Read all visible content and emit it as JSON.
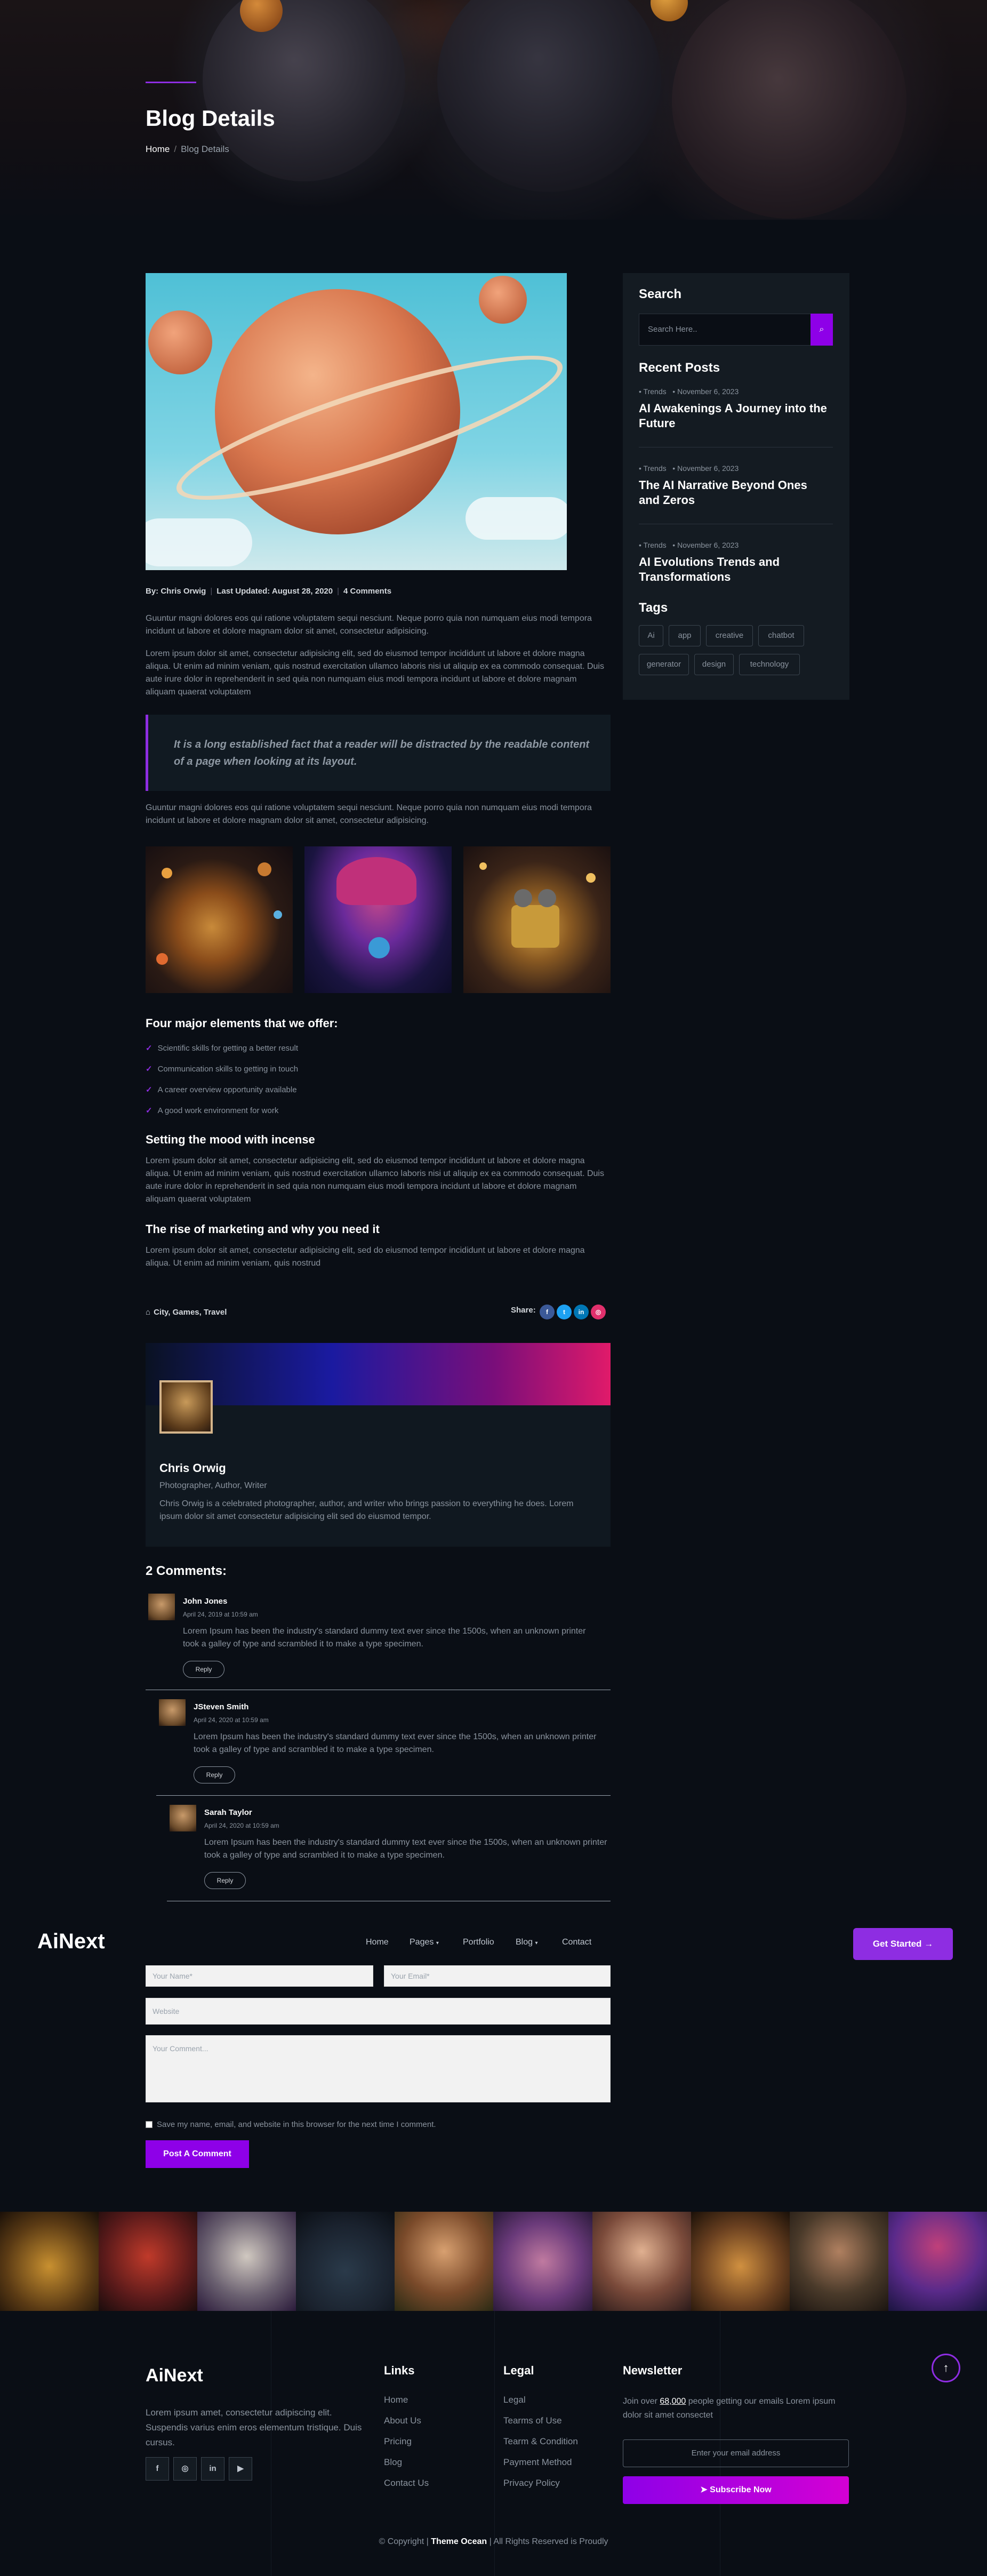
{
  "hero": {
    "title": "Blog Details",
    "breadcrumb": {
      "home": "Home",
      "separator": "/",
      "current": "Blog Details"
    }
  },
  "post": {
    "meta": {
      "author": "By: Chris Orwig",
      "updated": "Last Updated: August 28, 2020",
      "comments": "4 Comments"
    },
    "para1": "Guuntur magni dolores eos qui ratione voluptatem sequi nesciunt. Neque porro quia non numquam eius modi tempora incidunt ut labore et dolore magnam dolor sit amet, consectetur adipisicing.",
    "para2": "Lorem ipsum dolor sit amet, consectetur adipisicing elit, sed do eiusmod tempor incididunt ut labore et dolore magna aliqua. Ut enim ad minim veniam, quis nostrud exercitation ullamco laboris nisi ut aliquip ex ea commodo consequat. Duis aute irure dolor in reprehenderit in sed quia non numquam eius modi tempora incidunt ut labore et dolore magnam aliquam quaerat voluptatem",
    "quote": "It is a long established fact that a reader will be distracted by the readable content of a page when looking at its layout.",
    "para3": "Guuntur magni dolores eos qui ratione voluptatem sequi nesciunt. Neque porro quia non numquam eius modi tempora incidunt ut labore et dolore magnam dolor sit amet, consectetur adipisicing.",
    "elements_heading": "Four major elements that we offer:",
    "elements": [
      "Scientific skills for getting a better result",
      "Communication skills to getting in touch",
      "A career overview opportunity available",
      "A good work environment for work"
    ],
    "mood_heading": "Setting the mood with incense",
    "mood_text": "Lorem ipsum dolor sit amet, consectetur adipisicing elit, sed do eiusmod tempor incididunt ut labore et dolore magna aliqua. Ut enim ad minim veniam, quis nostrud exercitation ullamco laboris nisi ut aliquip ex ea commodo consequat. Duis aute irure dolor in reprehenderit in sed quia non numquam eius modi tempora incidunt ut labore et dolore magnam aliquam quaerat voluptatem",
    "rise_heading": "The rise of marketing and why you need it",
    "rise_text": "Lorem ipsum dolor sit amet, consectetur adipisicing elit, sed do eiusmod tempor incididunt ut labore et dolore magna aliqua. Ut enim ad minim veniam, quis nostrud",
    "tags_line": "City, Games, Travel",
    "share_label": "Share:",
    "share_icons": [
      "f",
      "t",
      "in",
      "◎"
    ]
  },
  "author": {
    "name": "Chris Orwig",
    "role": "Photographer, Author, Writer",
    "bio": "Chris Orwig is a celebrated photographer, author, and writer who brings passion to everything he does. Lorem ipsum dolor sit amet consectetur adipisicing elit sed do eiusmod tempor."
  },
  "comments": {
    "title": "2 Comments:",
    "items": [
      {
        "name": "John Jones",
        "date": "April 24, 2019 at 10:59 am",
        "text": "Lorem Ipsum has been the industry's standard dummy text ever since the 1500s, when an unknown printer took a galley of type and scrambled it to make a type specimen.",
        "reply": "Reply"
      },
      {
        "name": "JSteven Smith",
        "date": "April 24, 2020 at 10:59 am",
        "text": "Lorem Ipsum has been the industry's standard dummy text ever since the 1500s, when an unknown printer took a galley of type and scrambled it to make a type specimen.",
        "reply": "Reply"
      },
      {
        "name": "Sarah Taylor",
        "date": "April 24, 2020 at 10:59 am",
        "text": "Lorem Ipsum has been the industry's standard dummy text ever since the 1500s, when an unknown printer took a galley of type and scrambled it to make a type specimen.",
        "reply": "Reply"
      }
    ]
  },
  "nav": {
    "logo": "AiNext",
    "items": [
      "Home",
      "Pages",
      "Portfolio",
      "Blog",
      "Contact"
    ],
    "cta": "Get Started"
  },
  "form": {
    "name_ph": "Your Name*",
    "email_ph": "Your Email*",
    "website_ph": "Website",
    "comment_ph": "Your Comment...",
    "save_label": "Save my name, email, and website in this browser for the next time I comment.",
    "submit": "Post A Comment"
  },
  "sidebar": {
    "search_title": "Search",
    "search_ph": "Search Here..",
    "recent_title": "Recent Posts",
    "recent": [
      {
        "cat": "Trends",
        "date": "November 6, 2023",
        "title": "AI Awakenings A Journey into the Future"
      },
      {
        "cat": "Trends",
        "date": "November 6, 2023",
        "title": "The AI Narrative Beyond Ones and Zeros"
      },
      {
        "cat": "Trends",
        "date": "November 6, 2023",
        "title": "AI Evolutions Trends and Transformations"
      }
    ],
    "tags_title": "Tags",
    "tags": [
      "Ai",
      "app",
      "creative",
      "chatbot",
      "generator",
      "design",
      "technology"
    ]
  },
  "footer": {
    "logo": "AiNext",
    "text": "Lorem ipsum amet, consectetur adipiscing elit. Suspendis varius enim eros elementum tristique. Duis cursus.",
    "socials": [
      "f",
      "◎",
      "in",
      "▶"
    ],
    "links_title": "Links",
    "links": [
      "Home",
      "About Us",
      "Pricing",
      "Blog",
      "Contact Us"
    ],
    "legal_title": "Legal",
    "legal": [
      "Legal",
      "Tearms of Use",
      "Tearm & Condition",
      "Payment Method",
      "Privacy Policy"
    ],
    "news_title": "Newsletter",
    "news_pre": "Join over",
    "news_count": "68,000",
    "news_post": "people getting our emails Lorem ipsum dolor sit amet consectet",
    "news_ph": "Enter your email address",
    "news_btn": "Subscribe Now",
    "copy_pre": "© Copyright |",
    "copy_brand": "Theme Ocean",
    "copy_post": "| All Rights Reserved is Proudly"
  },
  "colors": {
    "accent": "#8e2de2",
    "bg": "#0a0e15"
  }
}
